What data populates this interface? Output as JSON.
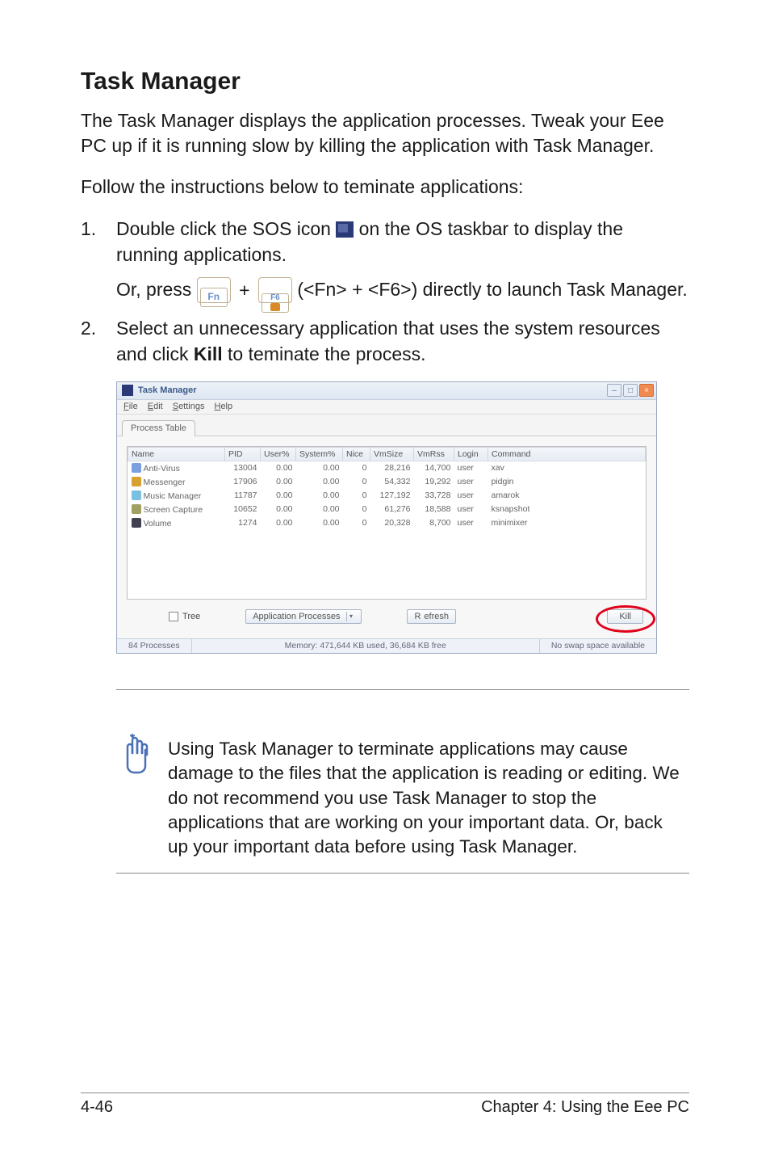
{
  "heading": "Task Manager",
  "intro": "The Task Manager displays the application processes. Tweak your Eee PC up if it is running slow by killing the application with Task Manager.",
  "instructions_lead": "Follow the instructions below to teminate applications:",
  "step1_num": "1.",
  "step1_a": "Double click the SOS icon ",
  "step1_b": " on the OS taskbar to display the running applications.",
  "step1_or_press": "Or, press ",
  "step1_plus": " + ",
  "step1_tail": " (<Fn> + <F6>) directly to launch Task Manager.",
  "key_fn": "Fn",
  "key_f6": "F6",
  "step2_num": "2.",
  "step2_a": "Select an unnecessary application that uses the system resources and click ",
  "step2_kill": "Kill",
  "step2_b": " to teminate the process.",
  "tm": {
    "title": "Task Manager",
    "menu": {
      "file": "File",
      "edit": "Edit",
      "settings": "Settings",
      "help": "Help"
    },
    "tab": "Process Table",
    "cols": [
      "Name",
      "PID",
      "User%",
      "System%",
      "Nice",
      "VmSize",
      "VmRss",
      "Login",
      "Command"
    ],
    "rows": [
      {
        "icon": "pi-av",
        "name": "Anti-Virus",
        "pid": "13004",
        "user": "0.00",
        "sys": "0.00",
        "nice": "0",
        "vmsize": "28,216",
        "vmrss": "14,700",
        "login": "user",
        "cmd": "xav"
      },
      {
        "icon": "pi-msg",
        "name": "Messenger",
        "pid": "17906",
        "user": "0.00",
        "sys": "0.00",
        "nice": "0",
        "vmsize": "54,332",
        "vmrss": "19,292",
        "login": "user",
        "cmd": "pidgin"
      },
      {
        "icon": "pi-music",
        "name": "Music Manager",
        "pid": "11787",
        "user": "0.00",
        "sys": "0.00",
        "nice": "0",
        "vmsize": "127,192",
        "vmrss": "33,728",
        "login": "user",
        "cmd": "amarok"
      },
      {
        "icon": "pi-screen",
        "name": "Screen Capture",
        "pid": "10652",
        "user": "0.00",
        "sys": "0.00",
        "nice": "0",
        "vmsize": "61,276",
        "vmrss": "18,588",
        "login": "user",
        "cmd": "ksnapshot"
      },
      {
        "icon": "pi-vol",
        "name": "Volume",
        "pid": "1274",
        "user": "0.00",
        "sys": "0.00",
        "nice": "0",
        "vmsize": "20,328",
        "vmrss": "8,700",
        "login": "user",
        "cmd": "minimixer"
      }
    ],
    "tree_label": "Tree",
    "app_proc_btn": "Application Processes",
    "refresh_btn": "Refresh",
    "kill_btn": "Kill",
    "status_procs": "84 Processes",
    "status_mem": "Memory: 471,644 KB used, 36,684 KB free",
    "status_swap": "No swap space available"
  },
  "note": "Using Task Manager to terminate applications may cause damage to the files that the application is reading or editing. We do not recommend you use Task Manager to stop the applications that are working on your important data. Or, back up your important data before using Task Manager.",
  "footer_left": "4-46",
  "footer_right": "Chapter 4: Using the Eee PC"
}
